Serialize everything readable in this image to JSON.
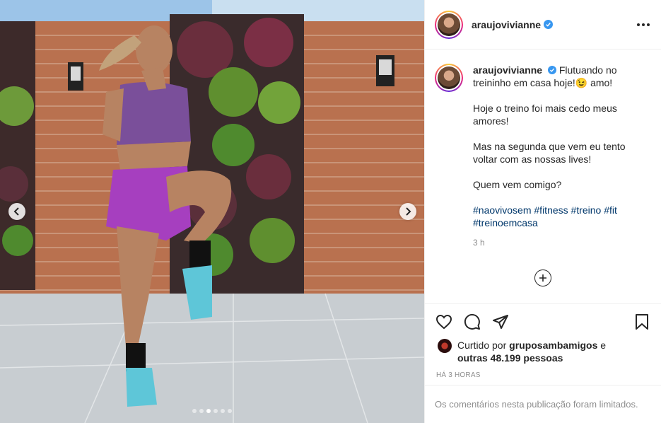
{
  "post": {
    "username": "araujovivianne",
    "verified": true,
    "caption_paragraphs": [
      "Flutuando no treininho em casa hoje!😉 amo!",
      "Hoje o treino foi mais cedo meus amores!",
      "Mas na segunda que vem eu tento voltar com as nossas lives!",
      "Quem vem comigo?"
    ],
    "hashtags": [
      "#naovivosem",
      "#fitness",
      "#treino",
      "#fit",
      "#treinoemcasa"
    ],
    "caption_age": "3 h",
    "liked_by_prefix": "Curtido por",
    "liked_by_user": "gruposambamigos",
    "liked_by_conjunction": "e",
    "others_label": "outras 48.199 pessoas",
    "timestamp": "HÁ 3 HORAS",
    "comments_notice": "Os comentários nesta publicação foram limitados."
  },
  "carousel": {
    "total_slides": 6,
    "active_index": 2
  },
  "icons": {
    "more": "more-options-icon",
    "like": "heart-icon",
    "comment": "comment-icon",
    "share": "paper-plane-icon",
    "save": "bookmark-icon",
    "load_more": "plus-circle-icon",
    "verified": "verified-badge-icon"
  },
  "colors": {
    "verified_blue": "#3897f0",
    "hashtag_blue": "#00376b",
    "muted_text": "#8e8e8e"
  }
}
